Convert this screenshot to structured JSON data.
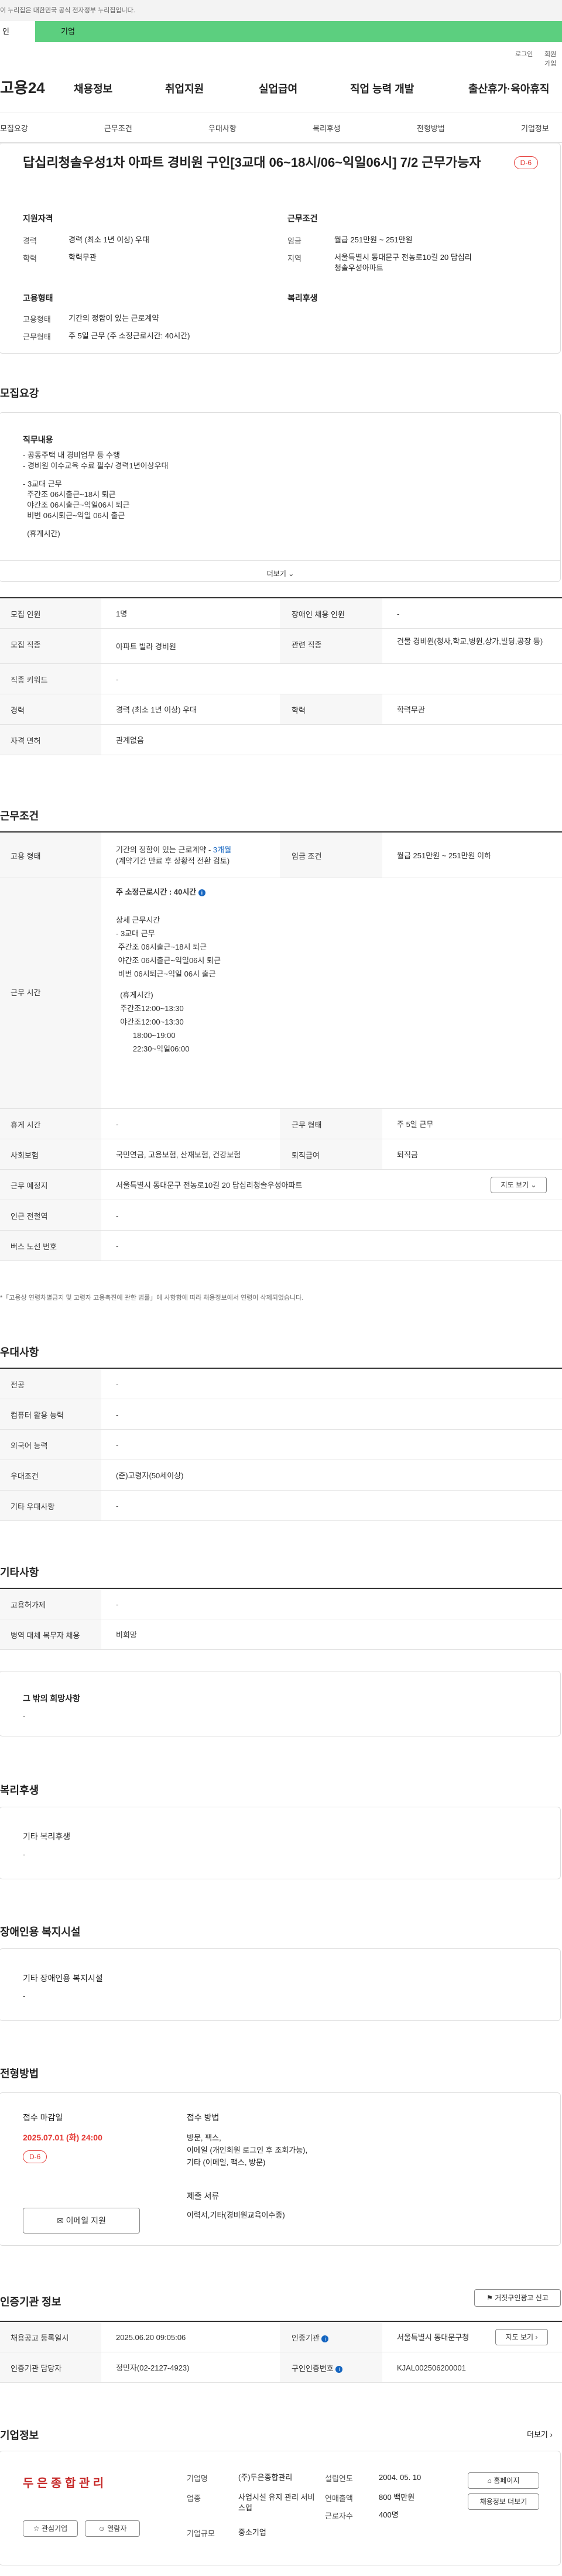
{
  "top": {
    "notice": "이 누리집은 대한민국 공식 전자정부 누리집입니다.",
    "sel_a": "인",
    "sel_b": "기업"
  },
  "util": {
    "login": "로그인",
    "join": "회원가입"
  },
  "gnb": {
    "logo": "고용24",
    "menu": [
      "채용정보",
      "취업지원",
      "실업급여",
      "직업 능력 개발",
      "출산휴가·육아휴직"
    ]
  },
  "tabs": [
    "모집요강",
    "근무조건",
    "우대사항",
    "복리후생",
    "전형방법",
    "기업정보"
  ],
  "job": {
    "title": "답십리청솔우성1차 아파트 경비원 구인[3교대 06~18시/06~익일06시] 7/2 근무가능자",
    "dday": "D-6",
    "qual_title": "지원자격",
    "career_l": "경력",
    "career_v": "경력 (최소 1년 이상) 우대",
    "edu_l": "학력",
    "edu_v": "학력무관",
    "work_title": "근무조건",
    "wage_l": "임금",
    "wage_v": "월급 251만원 ~ 251만원",
    "area_l": "지역",
    "area_v": "서울특별시 동대문구 전농로10길 20 답십리청솔우성아파트",
    "emp_title": "고용형태",
    "emptype_l": "고용형태",
    "emptype_v": "기간의 정함이 있는 근로계약",
    "workform_l": "근무형태",
    "workform_v": "주 5일 근무 (주 소정근로시간: 40시간)",
    "welfare_title": "복리후생"
  },
  "recruit": {
    "section": "모집요강",
    "duty_title": "직무내용",
    "duty_lines": [
      "- 공동주택 내 경비업무 등 수행",
      "- 경비원 이수교육 수료 필수/ 경력1년이상우대",
      "",
      "- 3교대 근무",
      "  주간조 06시출근~18시 퇴근",
      "  야간조 06시출근~익일06시 퇴근",
      "  비번 06시퇴근~익일 06시 출근",
      "",
      "  (휴게시간)"
    ],
    "more": "더보기",
    "rows": [
      {
        "l1": "모집 인원",
        "v1": "1명",
        "l2": "장애인 채용 인원",
        "v2": "-"
      },
      {
        "l1": "모집 직종",
        "v1": "아파트 빌라 경비원",
        "l2": "관련 직종",
        "v2": "건물 경비원(청사,학교,병원,상가,빌딩,공장 등)"
      },
      {
        "l1": "직종 키워드",
        "v1": "-"
      },
      {
        "l1": "경력",
        "v1": "경력 (최소 1년 이상) 우대",
        "l2": "학력",
        "v2": "학력무관"
      },
      {
        "l1": "자격 면허",
        "v1": "관계없음"
      }
    ]
  },
  "cond": {
    "section": "근무조건",
    "emp_l": "고용 형태",
    "emp_v1": "기간의 정함이 있는 근로계약 - ",
    "emp_link": "3개월",
    "emp_v2": "(계약기간 만료 후 상황적 전환 검토)",
    "wage_l": "임금 조건",
    "wage_v": "월급 251만원 ~ 251만원 이하",
    "time_l": "근무 시간",
    "time_head": "주 소정근로시간 : 40시간",
    "time_lines": [
      "상세 근무시간",
      "- 3교대 근무",
      " 주간조 06시출근~18시 퇴근",
      " 야간조 06시출근~익일06시 퇴근",
      " 비번 06시퇴근~익일 06시 출근",
      "",
      "  (휴게시간)",
      "  주간조12:00~13:30",
      "  야간조12:00~13:30",
      "        18:00~19:00",
      "        22:30~익일06:00"
    ],
    "rest_l": "휴게 시간",
    "rest_v": "-",
    "form_l": "근무 형태",
    "form_v": "주 5일 근무",
    "ins_l": "사회보험",
    "ins_v": "국민연금, 고용보험, 산재보험, 건강보험",
    "sev_l": "퇴직급여",
    "sev_v": "퇴직금",
    "place_l": "근무 예정지",
    "place_v": "서울특별시 동대문구 전농로10길 20 답십리청솔우성아파트",
    "map_btn": "지도 보기",
    "sub_l": "인근 전철역",
    "sub_v": "-",
    "bus_l": "버스 노선 번호",
    "bus_v": "-",
    "note": "*「고용상 연령차별금지 및 고령자 고용촉진에 관한 법률」에 사항함에 따라 채용정보에서 연령이 삭제되었습니다."
  },
  "pref": {
    "section": "우대사항",
    "rows": [
      [
        "전공",
        "-"
      ],
      [
        "컴퓨터 활용 능력",
        "-"
      ],
      [
        "외국어 능력",
        "-"
      ],
      [
        "우대조건",
        "(준)고령자(50세이상)"
      ],
      [
        "기타 우대사항",
        "-"
      ]
    ]
  },
  "etc": {
    "section": "기타사항",
    "rows": [
      [
        "고용허가제",
        "-"
      ],
      [
        "병역 대체 복무자 채용",
        "비희망"
      ]
    ],
    "other_title": "그 밖의 희망사항",
    "other_v": "-"
  },
  "welfare": {
    "section": "복리후생",
    "title": "기타 복리후생",
    "v": "-"
  },
  "disabled": {
    "section": "장애인용 복지시설",
    "title": "기타 장애인용 복지시설",
    "v": "-"
  },
  "process": {
    "section": "전형방법",
    "deadline_l": "접수 마감일",
    "deadline_v": "2025.07.01 (화) 24:00",
    "dday": "D-6",
    "email_btn": "이메일 지원",
    "method_l": "접수 방법",
    "method_lines": [
      "방문, 팩스,",
      "이메일 (개인회원 로그인 후 조회가능),",
      "기타 (이메일, 팩스, 방문)"
    ],
    "docs_l": "제출 서류",
    "docs_v": "이력서,기타(경비원교육이수증)"
  },
  "agency": {
    "section": "인증기관 정보",
    "report_btn": "거짓구인광고 신고",
    "reg_l": "채용공고 등록일시",
    "reg_v": "2025.06.20 09:05:06",
    "agency_l": "인증기관",
    "agency_v": "서울특별시 동대문구청",
    "map_btn": "지도 보기",
    "mgr_l": "인증기관 담당자",
    "mgr_v": "정민자(02-2127-4923)",
    "no_l": "구인인증번호",
    "no_v": "KJAL002506200001"
  },
  "company": {
    "section": "기업정보",
    "more": "더보기",
    "logo": "두 은 종 합 관 리",
    "interest_btn": "관심기업",
    "inquiry_btn": "열람자",
    "name_l": "기업명",
    "name_v": "(주)두은종합관리",
    "industry_l": "업종",
    "industry_v": "사업시설 유지 관리 서비스업",
    "scale_l": "기업규모",
    "scale_v": "중소기업",
    "founded_l": "설립연도",
    "founded_v": "2004. 05. 10",
    "sales_l": "연매출액",
    "sales_v": "800 백만원",
    "emp_l": "근로자수",
    "emp_v": "400명",
    "home_btn": "홈페이지",
    "jobs_btn": "채용정보 더보기"
  }
}
